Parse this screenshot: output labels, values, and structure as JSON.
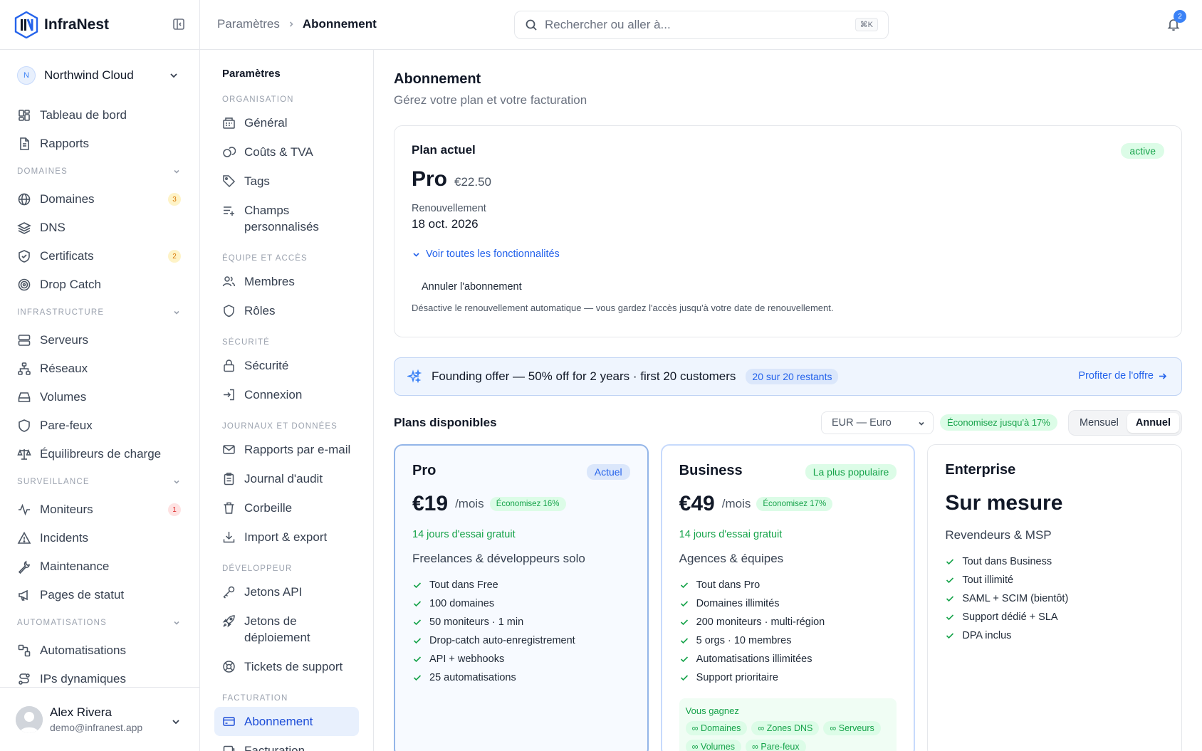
{
  "brand": {
    "name": "InfraNest"
  },
  "org": {
    "initial": "N",
    "name": "Northwind Cloud"
  },
  "nav": {
    "top": [
      {
        "label": "Tableau de bord"
      },
      {
        "label": "Rapports"
      }
    ],
    "sections": [
      {
        "title": "DOMAINES",
        "items": [
          {
            "label": "Domaines",
            "badge": "3"
          },
          {
            "label": "DNS"
          },
          {
            "label": "Certificats",
            "badge": "2"
          },
          {
            "label": "Drop Catch"
          }
        ]
      },
      {
        "title": "INFRASTRUCTURE",
        "items": [
          {
            "label": "Serveurs"
          },
          {
            "label": "Réseaux"
          },
          {
            "label": "Volumes"
          },
          {
            "label": "Pare-feux"
          },
          {
            "label": "Équilibreurs de charge"
          }
        ]
      },
      {
        "title": "SURVEILLANCE",
        "items": [
          {
            "label": "Moniteurs",
            "badge": "1"
          },
          {
            "label": "Incidents"
          },
          {
            "label": "Maintenance"
          },
          {
            "label": "Pages de statut"
          }
        ]
      },
      {
        "title": "AUTOMATISATIONS",
        "items": [
          {
            "label": "Automatisations"
          },
          {
            "label": "IPs dynamiques"
          }
        ]
      }
    ]
  },
  "user": {
    "name": "Alex Rivera",
    "email": "demo@infranest.app"
  },
  "topbar": {
    "breadcrumb": [
      "Paramètres",
      "Abonnement"
    ],
    "search_placeholder": "Rechercher ou aller à...",
    "search_shortcut": "⌘K",
    "notifications": "2"
  },
  "settings_nav": {
    "title": "Paramètres",
    "sections": [
      {
        "title": "ORGANISATION",
        "items": [
          "Général",
          "Coûts & TVA",
          "Tags",
          "Champs personnalisés"
        ]
      },
      {
        "title": "ÉQUIPE ET ACCÈS",
        "items": [
          "Membres",
          "Rôles"
        ]
      },
      {
        "title": "SÉCURITÉ",
        "items": [
          "Sécurité",
          "Connexion"
        ]
      },
      {
        "title": "JOURNAUX ET DONNÉES",
        "items": [
          "Rapports par e-mail",
          "Journal d'audit",
          "Corbeille",
          "Import & export"
        ]
      },
      {
        "title": "DÉVELOPPEUR",
        "items": [
          "Jetons API",
          "Jetons de déploiement",
          "Tickets de support"
        ]
      },
      {
        "title": "FACTURATION",
        "items": [
          "Abonnement",
          "Facturation"
        ]
      }
    ]
  },
  "page": {
    "title": "Abonnement",
    "subtitle": "Gérez votre plan et votre facturation"
  },
  "current_plan": {
    "label": "Plan actuel",
    "status": "active",
    "name": "Pro",
    "price": "€22.50",
    "renewal_label": "Renouvellement",
    "renewal_date": "18 oct. 2026",
    "features_link": "Voir toutes les fonctionnalités",
    "cancel_label": "Annuler l'abonnement",
    "cancel_desc": "Désactive le renouvellement automatique — vous gardez l'accès jusqu'à votre date de renouvellement."
  },
  "offer": {
    "text": "Founding offer — 50% off for 2 years · first 20 customers",
    "remaining": "20 sur 20 restants",
    "cta": "Profiter de l'offre"
  },
  "plans_header": {
    "title": "Plans disponibles",
    "currency": "EUR — Euro",
    "save": "Économisez jusqu'à 17%",
    "monthly": "Mensuel",
    "annual": "Annuel"
  },
  "plans": [
    {
      "name": "Pro",
      "tag": "Actuel",
      "price": "€19",
      "per": "/mois",
      "save": "Économisez 16%",
      "trial": "14 jours d'essai gratuit",
      "audience": "Freelances & développeurs solo",
      "features": [
        "Tout dans Free",
        "100 domaines",
        "50 moniteurs · 1 min",
        "Drop-catch auto-enregistrement",
        "API + webhooks",
        "25 automatisations"
      ]
    },
    {
      "name": "Business",
      "tag": "La plus populaire",
      "price": "€49",
      "per": "/mois",
      "save": "Économisez 17%",
      "trial": "14 jours d'essai gratuit",
      "audience": "Agences & équipes",
      "features": [
        "Tout dans Pro",
        "Domaines illimités",
        "200 moniteurs · multi-région",
        "5 orgs · 10 membres",
        "Automatisations illimitées",
        "Support prioritaire"
      ],
      "gain_title": "Vous gagnez",
      "gains": [
        "∞ Domaines",
        "∞ Zones DNS",
        "∞ Serveurs",
        "∞ Volumes",
        "∞ Pare-feux"
      ]
    },
    {
      "name": "Enterprise",
      "price_text": "Sur mesure",
      "audience": "Revendeurs & MSP",
      "features": [
        "Tout dans Business",
        "Tout illimité",
        "SAML + SCIM (bientôt)",
        "Support dédié + SLA",
        "DPA inclus"
      ]
    }
  ]
}
